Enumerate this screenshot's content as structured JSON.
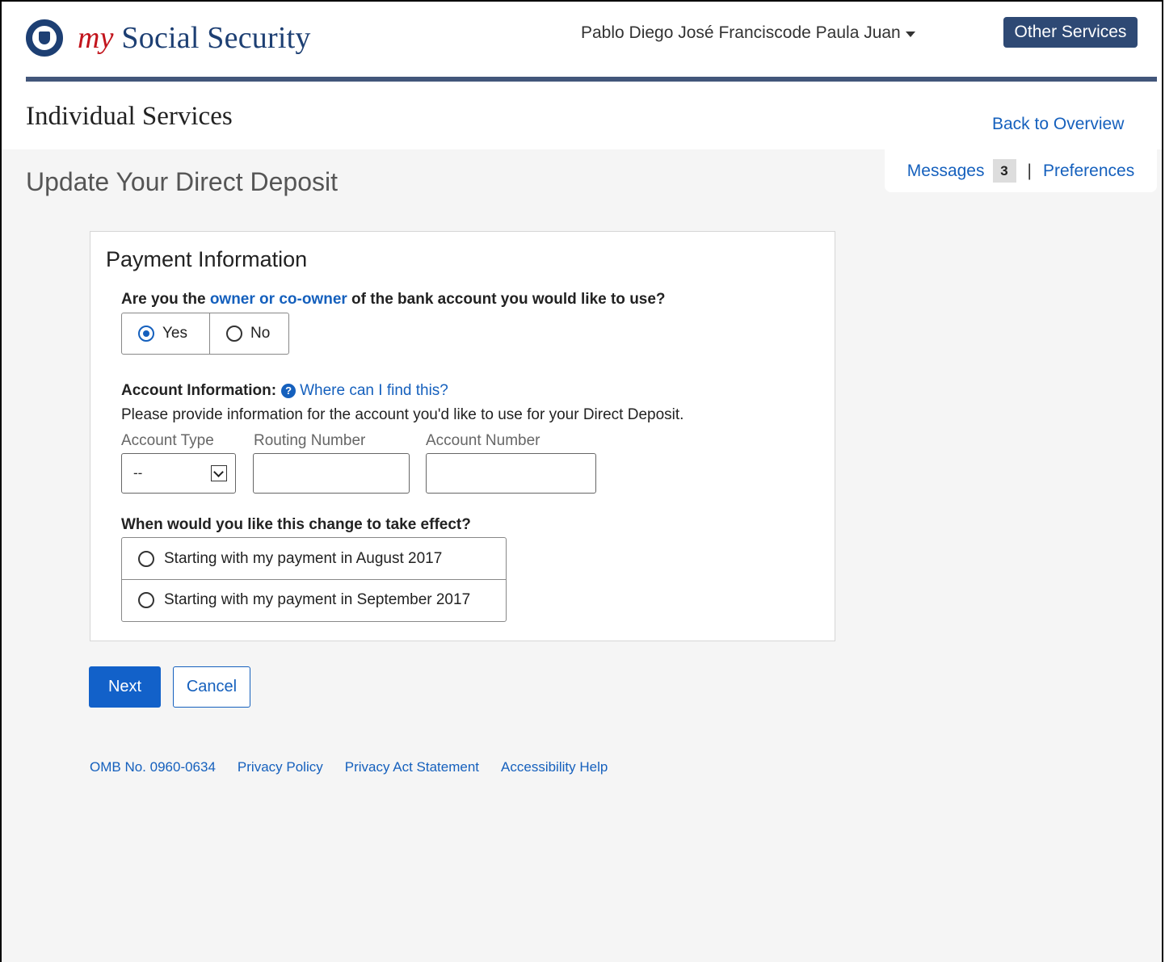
{
  "header": {
    "brand_my": "my",
    "brand_rest": " Social Security",
    "user_name": "Pablo Diego José Franciscode Paula Juan",
    "other_services": "Other Services",
    "section_title": "Individual Services",
    "back_link": "Back  to Overview"
  },
  "messages": {
    "messages_label": "Messages",
    "count": "3",
    "separator": "|",
    "preferences_label": "Preferences"
  },
  "page_title": "Update Your Direct Deposit",
  "form": {
    "card_title": "Payment Information",
    "owner_question_pre": "Are you the ",
    "owner_question_link": "owner or co-owner",
    "owner_question_post": " of the bank account you would like to use?",
    "owner_options": [
      {
        "label": "Yes",
        "checked": true
      },
      {
        "label": "No",
        "checked": false
      }
    ],
    "account_info_label": "Account Information:",
    "help_link": "Where can I find this?",
    "account_desc": "Please provide information for the account you'd like to use for your Direct Deposit.",
    "account_type_label": "Account Type",
    "account_type_value": "--",
    "routing_label": "Routing Number",
    "routing_value": "",
    "account_number_label": "Account Number",
    "account_number_value": "",
    "effect_question": "When would you like this change to take effect?",
    "effect_options": [
      {
        "label": "Starting with my payment in August 2017",
        "checked": false
      },
      {
        "label": "Starting with my payment in September 2017",
        "checked": false
      }
    ]
  },
  "buttons": {
    "next": "Next",
    "cancel": "Cancel"
  },
  "footer": {
    "links": [
      "OMB No. 0960-0634",
      "Privacy Policy",
      "Privacy Act Statement",
      "Accessibility Help"
    ]
  },
  "colors": {
    "brand_navy": "#1d3f73",
    "link_blue": "#1560bd",
    "primary_button": "#1261c9",
    "header_button": "#2e4974"
  }
}
